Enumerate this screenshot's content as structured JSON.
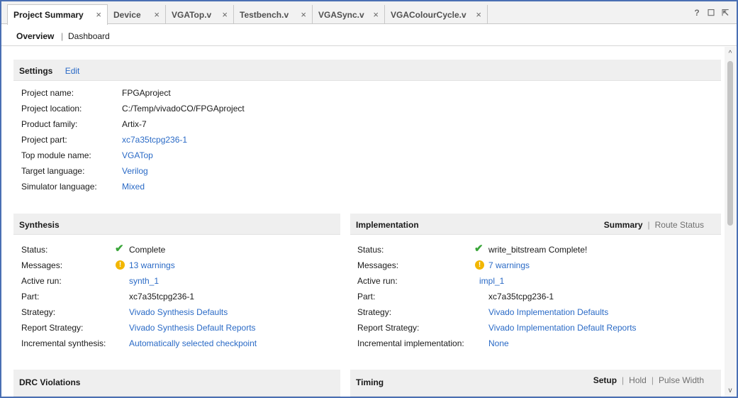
{
  "tabs": [
    {
      "label": "Project Summary",
      "close": "×"
    },
    {
      "label": "Device",
      "close": "×"
    },
    {
      "label": "VGATop.v",
      "close": "×"
    },
    {
      "label": "Testbench.v",
      "close": "×"
    },
    {
      "label": "VGASync.v",
      "close": "×"
    },
    {
      "label": "VGAColourCycle.v",
      "close": "×"
    }
  ],
  "window_icons": {
    "help": "?",
    "restore": "☐",
    "float": "⇱"
  },
  "subnav": {
    "overview": "Overview",
    "separator": "|",
    "dashboard": "Dashboard"
  },
  "settings": {
    "title": "Settings",
    "edit": "Edit",
    "rows": [
      {
        "label": "Project name:",
        "value": "FPGAproject"
      },
      {
        "label": "Project location:",
        "value": "C:/Temp/vivadoCO/FPGAproject"
      },
      {
        "label": "Product family:",
        "value": "Artix-7"
      },
      {
        "label": "Project part:",
        "value": "xc7a35tcpg236-1"
      },
      {
        "label": "Top module name:",
        "value": "VGATop"
      },
      {
        "label": "Target language:",
        "value": "Verilog"
      },
      {
        "label": "Simulator language:",
        "value": "Mixed"
      }
    ]
  },
  "synthesis": {
    "title": "Synthesis",
    "status_label": "Status:",
    "status_value": "Complete",
    "messages_label": "Messages:",
    "messages_value": "13 warnings",
    "active_run_label": "Active run:",
    "active_run_value": "synth_1",
    "part_label": "Part:",
    "part_value": "xc7a35tcpg236-1",
    "strategy_label": "Strategy:",
    "strategy_value": "Vivado Synthesis Defaults",
    "report_label": "Report Strategy:",
    "report_value": "Vivado Synthesis Default Reports",
    "incremental_label": "Incremental synthesis:",
    "incremental_value": "Automatically selected checkpoint"
  },
  "implementation": {
    "title": "Implementation",
    "tab_summary": "Summary",
    "tab_separator": "|",
    "tab_route": "Route Status",
    "status_label": "Status:",
    "status_value": "write_bitstream Complete!",
    "messages_label": "Messages:",
    "messages_value": "7 warnings",
    "active_run_label": "Active run:",
    "active_run_value": "impl_1",
    "part_label": "Part:",
    "part_value": "xc7a35tcpg236-1",
    "strategy_label": "Strategy:",
    "strategy_value": "Vivado Implementation Defaults",
    "report_label": "Report Strategy:",
    "report_value": "Vivado Implementation Default Reports",
    "incremental_label": "Incremental implementation:",
    "incremental_value": "None"
  },
  "drc": {
    "title": "DRC Violations"
  },
  "timing": {
    "title": "Timing",
    "tab_setup": "Setup",
    "sep1": "|",
    "tab_hold": "Hold",
    "sep2": "|",
    "tab_pulse": "Pulse Width"
  },
  "icons": {
    "check": "✔",
    "warn": "!",
    "scroll_up": "^",
    "scroll_down": "v"
  },
  "colors": {
    "link": "#2a6ac6",
    "frame": "#4a6fb3",
    "check": "#3aa63a",
    "warn": "#f2b600"
  }
}
